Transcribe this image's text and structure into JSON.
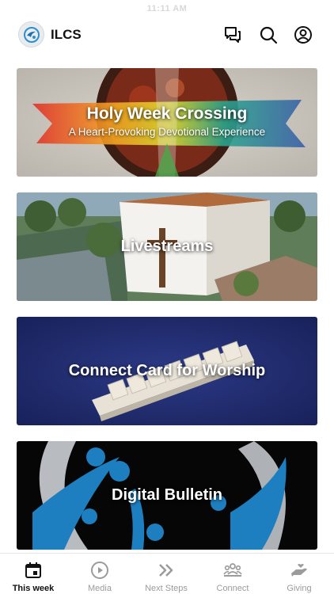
{
  "status_bar": {
    "time": "11:11 AM"
  },
  "header": {
    "title": "ILCS",
    "icons": [
      "logo-icon",
      "chat-icon",
      "search-icon",
      "profile-icon"
    ]
  },
  "cards": [
    {
      "title": "Holy Week Crossing",
      "subtitle": "A Heart-Provoking Devotional Experience"
    },
    {
      "title": "Livestreams"
    },
    {
      "title": "Connect Card for Worship"
    },
    {
      "title": "Digital Bulletin"
    }
  ],
  "tabs": [
    {
      "label": "This week",
      "icon": "calendar-icon",
      "active": true
    },
    {
      "label": "Media",
      "icon": "play-icon",
      "active": false
    },
    {
      "label": "Next Steps",
      "icon": "next-steps-icon",
      "active": false
    },
    {
      "label": "Connect",
      "icon": "people-icon",
      "active": false
    },
    {
      "label": "Giving",
      "icon": "giving-icon",
      "active": false
    }
  ],
  "colors": {
    "active_tab": "#111111",
    "inactive_tab": "#9b9b9b",
    "brand_blue": "#1e88c8"
  }
}
